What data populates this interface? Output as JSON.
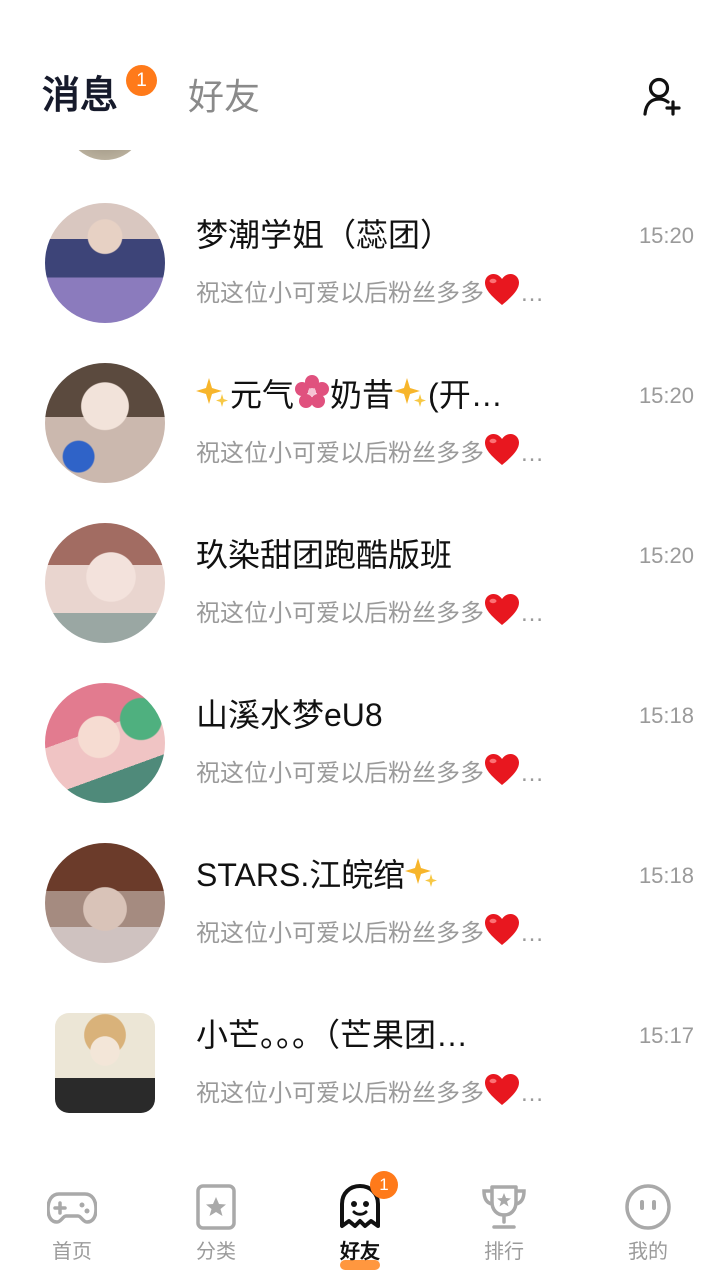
{
  "header": {
    "tab_messages": "消息",
    "tab_messages_badge": "1",
    "tab_friends": "好友"
  },
  "conversations": [
    {
      "name_parts": [
        "梦潮学姐（蕊团）"
      ],
      "time": "15:20",
      "preview": "祝这位小可爱以后粉丝多多",
      "avatar_colors": [
        "#d9c7c0",
        "#4b4f8a",
        "#8b7bbd"
      ]
    },
    {
      "name_parts": [
        "元气",
        "奶昔",
        "(开…"
      ],
      "time": "15:20",
      "preview": "祝这位小可爱以后粉丝多多",
      "avatar_colors": [
        "#e4d8cf",
        "#5b4a3e",
        "#3d6fc4"
      ]
    },
    {
      "name_parts": [
        "玖染甜团跑酷版班"
      ],
      "time": "15:20",
      "preview": "祝这位小可爱以后粉丝多多",
      "avatar_colors": [
        "#e9d5cf",
        "#a26c62",
        "#b9c3bf"
      ]
    },
    {
      "name_parts": [
        "山溪水梦eU8"
      ],
      "time": "15:18",
      "preview": "祝这位小可爱以后粉丝多多",
      "avatar_colors": [
        "#f0c4c4",
        "#63b58e",
        "#e27b8f"
      ]
    },
    {
      "name_parts": [
        "STARS.江皖绾"
      ],
      "time": "15:18",
      "preview": "祝这位小可爱以后粉丝多多",
      "avatar_colors": [
        "#cfc2c0",
        "#6b3b2a",
        "#a58b80"
      ]
    },
    {
      "name_parts": [
        "小芒。。。（芒果团…"
      ],
      "time": "15:17",
      "preview": "祝这位小可爱以后粉丝多多",
      "avatar_colors": [
        "#ece6d6",
        "#d9b27a",
        "#2a2a2a"
      ]
    }
  ],
  "ellipsis": "…",
  "nav": {
    "items": [
      {
        "label": "首页",
        "icon": "gamepad-icon"
      },
      {
        "label": "分类",
        "icon": "category-star-icon"
      },
      {
        "label": "好友",
        "icon": "ghost-friends-icon",
        "badge": "1"
      },
      {
        "label": "排行",
        "icon": "trophy-icon"
      },
      {
        "label": "我的",
        "icon": "profile-face-icon"
      }
    ]
  },
  "colors": {
    "accent": "#ff7a1a",
    "text_primary": "#111111",
    "text_secondary": "#9a9a9a"
  }
}
